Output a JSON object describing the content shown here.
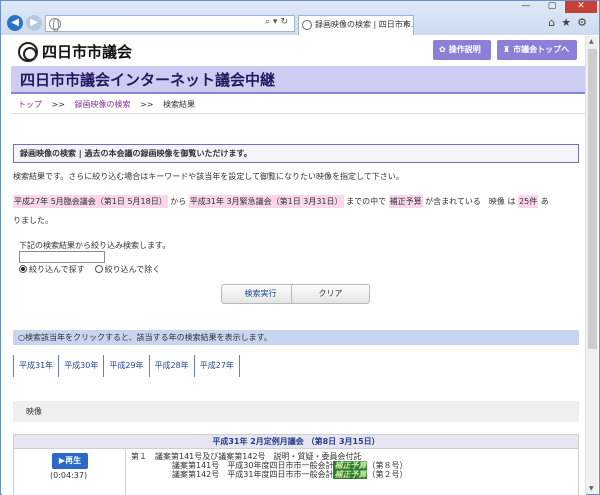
{
  "browser": {
    "tab_title": "録画映像の検索 | 四日市市...",
    "window_controls": [
      "—",
      "▢",
      "✕"
    ],
    "toolbar_icons": [
      "home-icon",
      "star-icon",
      "gear-icon"
    ]
  },
  "site": {
    "logo_text": "四日市市議会",
    "help_button": "操作説明",
    "top_button": "市議会トップへ",
    "banner_title": "四日市市議会インターネット議会中継"
  },
  "breadcrumb": {
    "home": "トップ",
    "sep": ">>",
    "search": "録画映像の検索",
    "current": "検索結果"
  },
  "info": {
    "box_text": "録画映像の検索 | 過去の本会議の録画映像を御覧いただけます。",
    "result_intro": "検索結果です。さらに絞り込む場合はキーワードや該当年を設定して御覧になりたい映像を指定して下さい。"
  },
  "summary": {
    "from_session": "平成27年 5月臨会議会（第1日 5月18日）",
    "from_word": "から",
    "to_session": "平成31年 3月緊急議会（第1日 3月31日）",
    "within_word": "までの中で",
    "keyword": "補正予算",
    "contains_word": "が含まれている　映像 は",
    "count": "25件",
    "trailing": "あ",
    "line2": "りました。"
  },
  "filter": {
    "label": "下記の検索結果から絞り込み検索します。",
    "input_value": "",
    "radio_narrow": "絞り込んで探す",
    "radio_exclude": "絞り込んで除く",
    "search_button": "検索実行",
    "clear_button": "クリア"
  },
  "years": {
    "instruction": "○検索該当年をクリックすると、該当する年の検索結果を表示します。",
    "items": [
      "平成31年",
      "平成30年",
      "平成29年",
      "平成28年",
      "平成27年"
    ]
  },
  "video": {
    "label": "映像",
    "session_title": "平成31年 2月定例月議会 （第8日 3月15日）",
    "play_label": "再生",
    "duration": "(0:04:37)",
    "agenda_line1": "第１　議案第141号及び議案第142号　説明・質疑・委員会付託",
    "agenda_line2_prefix": "議案第141号　平成30年度四日市市一般会計",
    "agenda_line2_keyword": "補正予算",
    "agenda_line2_suffix": "（第８号）",
    "agenda_line3_prefix": "議案第142号　平成31年度四日市市一般会計",
    "agenda_line3_keyword": "補正予算",
    "agenda_line3_suffix": "（第２号）"
  }
}
